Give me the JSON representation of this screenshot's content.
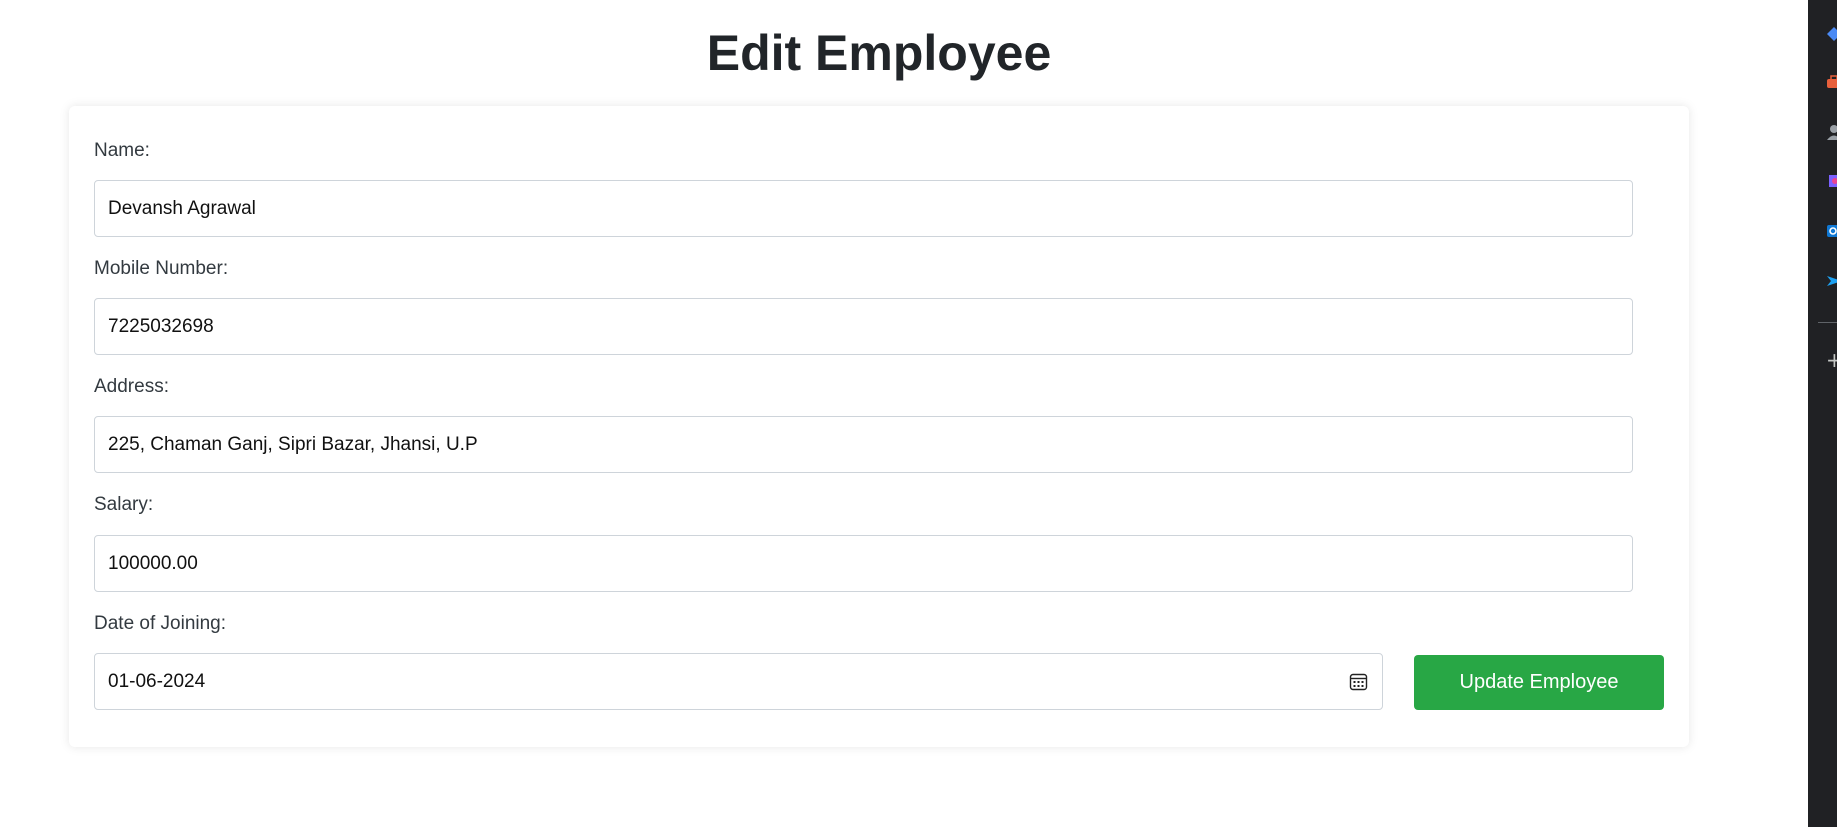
{
  "page": {
    "title": "Edit Employee"
  },
  "form": {
    "name": {
      "label": "Name:",
      "value": "Devansh Agrawal"
    },
    "mobile": {
      "label": "Mobile Number:",
      "value": "7225032698"
    },
    "address": {
      "label": "Address:",
      "value": "225, Chaman Ganj, Sipri Bazar, Jhansi, U.P"
    },
    "salary": {
      "label": "Salary:",
      "value": "100000.00"
    },
    "date_of_joining": {
      "label": "Date of Joining:",
      "value": "01-06-2024",
      "icon": "calendar-icon"
    },
    "submit_label": "Update Employee"
  },
  "browser_sidebar": {
    "icons": [
      "diamond-icon",
      "briefcase-icon",
      "person-icon",
      "copilot-icon",
      "outlook-icon",
      "send-icon",
      "add-icon"
    ]
  },
  "colors": {
    "accent": "#28a745",
    "sidebar": "#202124",
    "text": "#212529",
    "border": "#ced4da"
  }
}
